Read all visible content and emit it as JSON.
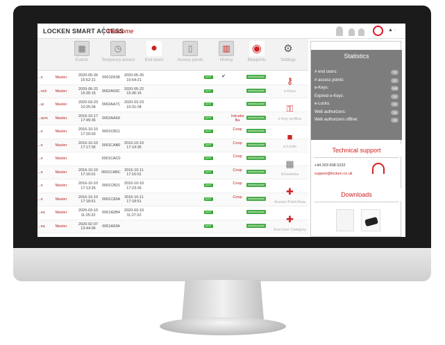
{
  "app": {
    "brand": "LOCKEN SMART ACCESS",
    "welcome": "Welcome",
    "user_menu": "▲ ·"
  },
  "toolbar": {
    "items": [
      {
        "label": "Events",
        "icon": "calendar-grid-icon"
      },
      {
        "label": "Temporary access",
        "icon": "calendar-clock-icon"
      },
      {
        "label": "End users",
        "icon": "person-icon"
      },
      {
        "label": "Access points",
        "icon": "door-icon"
      },
      {
        "label": "History",
        "icon": "bar-chart-icon"
      },
      {
        "label": "Blueprints",
        "icon": "map-pin-icon"
      },
      {
        "label": "Settings",
        "icon": "gears-icon"
      }
    ]
  },
  "table": {
    "rows": [
      {
        "name": "...e",
        "role": "Master",
        "date1": "2020-05-26",
        "time1": "15:52:21",
        "code": "0001D538",
        "date2": "2020-05-26",
        "time2": "15:54:21",
        "state": "good",
        "check": "✔",
        "zone": "",
        "action": "allowed/update"
      },
      {
        "name": "...nch",
        "role": "Master",
        "date1": "2020-05-22",
        "time1": "15:35:15",
        "code": "0002A93C",
        "date2": "2020-05-22",
        "time2": "15:36:15",
        "state": "good",
        "check": "",
        "zone": "",
        "action": "allowed/update"
      },
      {
        "name": "...ai",
        "role": "Master",
        "date1": "2020-03-23",
        "time1": "10:25:04",
        "code": "0002AA7C",
        "date2": "2020-03-23",
        "time2": "10:31:04",
        "state": "good",
        "check": "",
        "zone": "",
        "action": "allowed/update"
      },
      {
        "name": "...acm",
        "role": "Master",
        "date1": "2016-10-17",
        "time1": "17:45:36",
        "code": "0002AA69",
        "date2": "",
        "time2": "",
        "state": "good",
        "check": "",
        "zone": "Intruder Ba",
        "action": "allowed/update"
      },
      {
        "name": "...e",
        "role": "Master",
        "date1": "2016-10-10",
        "time1": "17:20:03",
        "code": "0001CB11",
        "date2": "",
        "time2": "",
        "state": "good",
        "check": "",
        "zone": "Coop",
        "action": "allowed/update"
      },
      {
        "name": "...e",
        "role": "Master",
        "date1": "2016-10-10",
        "time1": "17:17:35",
        "code": "0001CAB0",
        "date2": "2016-10-10",
        "time2": "17:19:35",
        "state": "good",
        "check": "",
        "zone": "Coop",
        "action": "allowed/update"
      },
      {
        "name": "...e",
        "role": "Master",
        "date1": "",
        "time1": "",
        "code": "0001CAC0",
        "date2": "",
        "time2": "",
        "state": "good",
        "check": "",
        "zone": "Coop",
        "action": "allowed/update"
      },
      {
        "name": "...e",
        "role": "Master",
        "date1": "2016-10-10",
        "time1": "17:16:01",
        "code": "0001CABC",
        "date2": "2016-10-11",
        "time2": "17:16:01",
        "state": "good",
        "check": "",
        "zone": "Coop",
        "action": "allowed/update"
      },
      {
        "name": "...e",
        "role": "Master",
        "date1": "2016-10-10",
        "time1": "17:13:26",
        "code": "0001CB21",
        "date2": "2016-10-10",
        "time2": "17:23:26",
        "state": "good",
        "check": "",
        "zone": "Coop",
        "action": "allowed/update"
      },
      {
        "name": "...e",
        "role": "Master",
        "date1": "2016-10-10",
        "time1": "17:18:51",
        "code": "0001C83A",
        "date2": "2016-10-11",
        "time2": "17:18:51",
        "state": "good",
        "check": "",
        "zone": "Coop",
        "action": "allowed/update"
      },
      {
        "name": "...ea",
        "role": "Master",
        "date1": "2020-03-10",
        "time1": "11:25:22",
        "code": "0001A2B4",
        "date2": "2020-03-10",
        "time2": "11:27:22",
        "state": "good",
        "check": "",
        "zone": "",
        "action": "allowed/update"
      },
      {
        "name": "...ea",
        "role": "Master",
        "date1": "2020-02-07",
        "time1": "13:44:06",
        "code": "0001A93A",
        "date2": "",
        "time2": "",
        "state": "good",
        "check": "",
        "zone": "",
        "action": "allowed/update"
      }
    ]
  },
  "side_tools": [
    {
      "label": "e-Keys",
      "icon": "e-key-icon"
    },
    {
      "label": "e-Key profiles",
      "icon": "key-profile-icon"
    },
    {
      "label": "e-Locks",
      "icon": "padlock-icon"
    },
    {
      "label": "Schedules",
      "icon": "schedule-icon"
    },
    {
      "label": "Access Point Area",
      "icon": "access-point-area-icon"
    },
    {
      "label": "End User Category",
      "icon": "user-category-icon"
    }
  ],
  "statistics": {
    "title": "Statistics",
    "rows": [
      {
        "label": "# end users:",
        "value": "73"
      },
      {
        "label": "# access points:",
        "value": "27"
      },
      {
        "label": "e-Keys:",
        "value": "145"
      },
      {
        "label": "Expired e-Keys:",
        "value": "70"
      },
      {
        "label": "e-Locks:",
        "value": "24"
      },
      {
        "label": "Web authorizers:",
        "value": "26"
      },
      {
        "label": "Web authorizers offline:",
        "value": "15"
      }
    ]
  },
  "support": {
    "title": "Technical support",
    "phone": "+44 203 608 0232",
    "email": "support@locken.co.uk"
  },
  "downloads": {
    "title": "Downloads"
  },
  "colors": {
    "accent": "#c22222",
    "stats_bg": "#7d7d7d",
    "good": "#33aa33"
  }
}
